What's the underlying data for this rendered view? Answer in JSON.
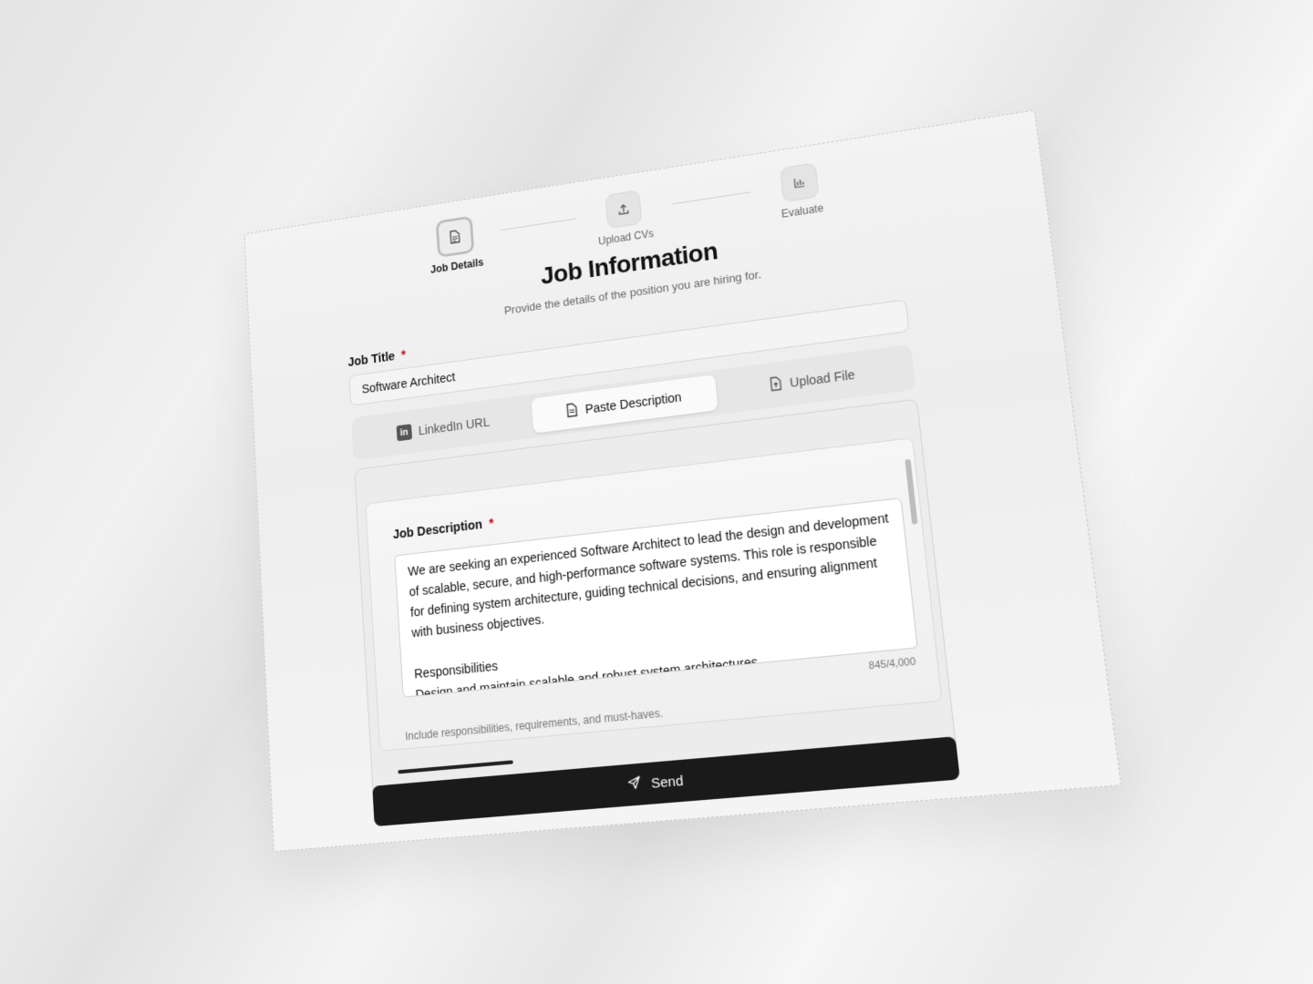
{
  "stepper": {
    "steps": [
      {
        "label": "Job Details",
        "icon": "document-icon",
        "active": true
      },
      {
        "label": "Upload CVs",
        "icon": "upload-icon",
        "active": false
      },
      {
        "label": "Evaluate",
        "icon": "bar-chart-icon",
        "active": false
      }
    ]
  },
  "header": {
    "title": "Job Information",
    "subtitle": "Provide the details of the position you are hiring for."
  },
  "job_title": {
    "label": "Job Title",
    "required_mark": "*",
    "value": "Software Architect"
  },
  "tabs": [
    {
      "label": "LinkedIn URL",
      "icon": "linkedin-icon",
      "active": false
    },
    {
      "label": "Paste Description",
      "icon": "document-icon",
      "active": true
    },
    {
      "label": "Upload File",
      "icon": "file-upload-icon",
      "active": false
    }
  ],
  "description": {
    "label": "Job Description",
    "required_mark": "*",
    "value": "We are seeking an experienced Software Architect to lead the design and development of scalable, secure, and high-performance software systems. This role is responsible for defining system architecture, guiding technical decisions, and ensuring alignment with business objectives.\n\nResponsibilities\nDesign and maintain scalable and robust system architectures\nDefine and enforce technical standards, guidelines, and best practices",
    "counter": "845/4,000",
    "hint": "Include responsibilities, requirements, and must-haves.",
    "progress": 0.23
  },
  "send": {
    "label": "Send",
    "icon": "send-icon"
  },
  "li_badge": "in"
}
